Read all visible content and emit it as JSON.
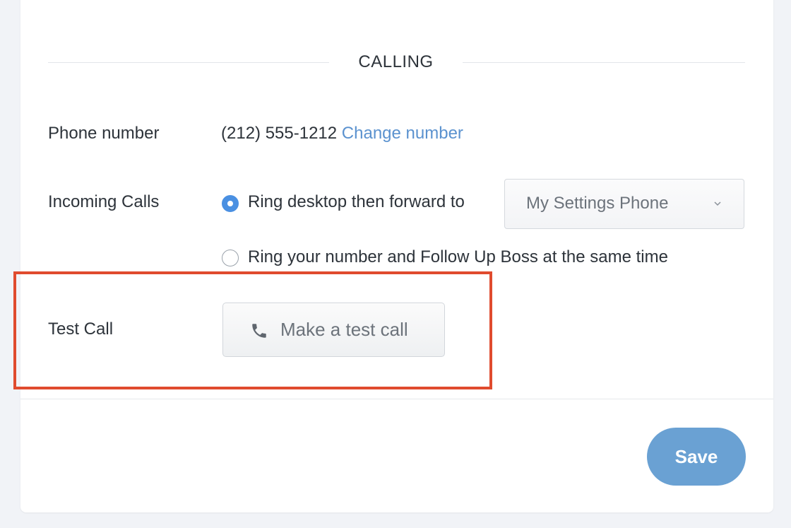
{
  "section": {
    "title": "CALLING"
  },
  "phone_number": {
    "label": "Phone number",
    "value": "(212) 555-1212",
    "change_link": "Change number"
  },
  "incoming_calls": {
    "label": "Incoming Calls",
    "options": [
      {
        "label": "Ring desktop then forward to",
        "selected": true
      },
      {
        "label": "Ring your number and Follow Up Boss at the same time",
        "selected": false
      }
    ],
    "forward_select": {
      "value": "My Settings Phone",
      "icon": "chevron-down-icon"
    }
  },
  "test_call": {
    "label": "Test Call",
    "button_label": "Make a test call",
    "button_icon": "phone-icon"
  },
  "footer": {
    "save_label": "Save"
  },
  "colors": {
    "accent": "#4a90e2",
    "link": "#5b92cf",
    "save_button": "#6aa1d3",
    "highlight": "#e04b2e"
  }
}
